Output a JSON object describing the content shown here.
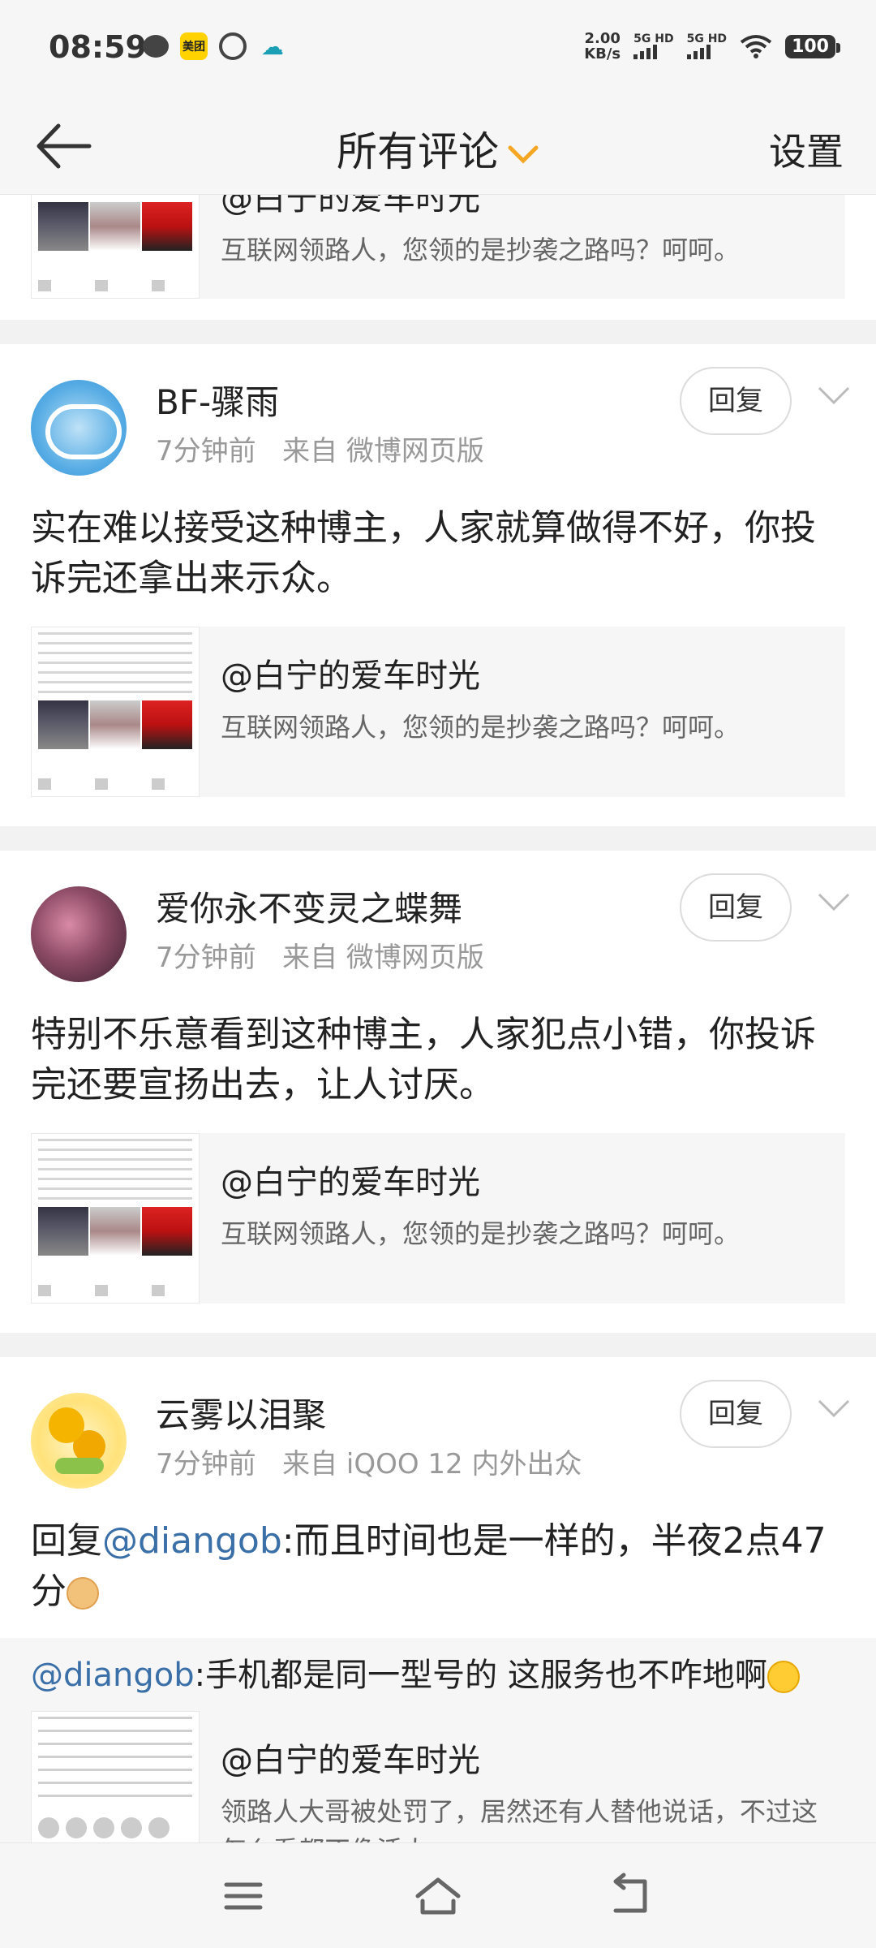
{
  "status_bar": {
    "time": "08:59",
    "app_icons": [
      "wechat-icon",
      "meituan-icon",
      "ring-icon",
      "cloud-icon"
    ],
    "meituan_label": "美团",
    "net_speed_value": "2.00",
    "net_speed_unit": "KB/s",
    "signal1_label": "5G HD",
    "signal2_label": "5G HD",
    "battery": "100"
  },
  "nav": {
    "title": "所有评论",
    "settings_label": "设置"
  },
  "top_quote": {
    "title": "@白宁的爱车时光",
    "desc": "互联网领路人，您领的是抄袭之路吗？呵呵。"
  },
  "comments": [
    {
      "name": "BF-骤雨",
      "time": "7分钟前",
      "source": "来自 微博网页版",
      "reply_label": "回复",
      "text": "实在难以接受这种博主，人家就算做得不好，你投诉完还拿出来示众。",
      "quote_title": "@白宁的爱车时光",
      "quote_desc": "互联网领路人，您领的是抄袭之路吗？呵呵。"
    },
    {
      "name": "爱你永不变灵之蝶舞",
      "time": "7分钟前",
      "source": "来自 微博网页版",
      "reply_label": "回复",
      "text": "特别不乐意看到这种博主，人家犯点小错，你投诉完还要宣扬出去，让人讨厌。",
      "quote_title": "@白宁的爱车时光",
      "quote_desc": "互联网领路人，您领的是抄袭之路吗？呵呵。"
    },
    {
      "name": "云雾以泪聚",
      "time": "7分钟前",
      "source": "来自 iQOO 12 内外出众",
      "reply_label": "回复",
      "reply_prefix": "回复",
      "mention": "@diangob",
      "text": ":而且时间也是一样的，半夜2点47分",
      "sub_mention": "@diangob",
      "sub_text": ":手机都是同一型号的 这服务也不咋地啊",
      "quote_title": "@白宁的爱车时光",
      "quote_desc": "领路人大哥被处罚了，居然还有人替他说话，不过这怎么看都不像活人。"
    }
  ],
  "colors": {
    "mention": "#3a6fa8",
    "accent_chevron": "#f5a623",
    "meta": "#999999",
    "divider": "#f2f2f2"
  },
  "bottom_nav": [
    "menu-icon",
    "home-icon",
    "back-icon"
  ]
}
